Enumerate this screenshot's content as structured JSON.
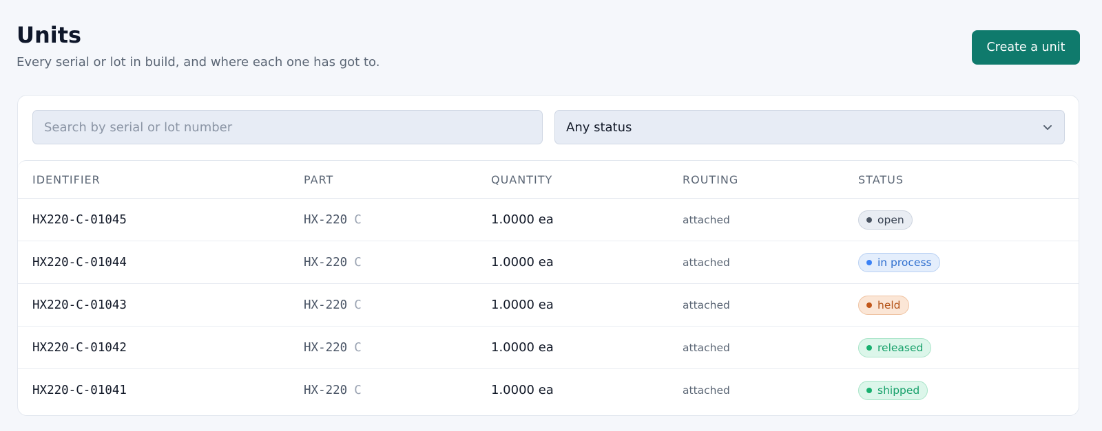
{
  "header": {
    "title": "Units",
    "subtitle": "Every serial or lot in build, and where each one has got to.",
    "create_button_label": "Create a unit"
  },
  "filters": {
    "search_placeholder": "Search by serial or lot number",
    "search_value": "",
    "status_select_value": "Any status",
    "status_icon": "chevron-down-icon"
  },
  "table": {
    "columns": [
      "IDENTIFIER",
      "PART",
      "QUANTITY",
      "ROUTING",
      "STATUS"
    ],
    "rows": [
      {
        "identifier": "HX220-C-01045",
        "part_number": "HX-220",
        "part_rev": "C",
        "quantity": "1.0000 ea",
        "routing": "attached",
        "status": "open"
      },
      {
        "identifier": "HX220-C-01044",
        "part_number": "HX-220",
        "part_rev": "C",
        "quantity": "1.0000 ea",
        "routing": "attached",
        "status": "in process"
      },
      {
        "identifier": "HX220-C-01043",
        "part_number": "HX-220",
        "part_rev": "C",
        "quantity": "1.0000 ea",
        "routing": "attached",
        "status": "held"
      },
      {
        "identifier": "HX220-C-01042",
        "part_number": "HX-220",
        "part_rev": "C",
        "quantity": "1.0000 ea",
        "routing": "attached",
        "status": "released"
      },
      {
        "identifier": "HX220-C-01041",
        "part_number": "HX-220",
        "part_rev": "C",
        "quantity": "1.0000 ea",
        "routing": "attached",
        "status": "shipped"
      }
    ]
  },
  "colors": {
    "accent": "#0f7a6c",
    "status": {
      "open": {
        "bg": "#e9edf3",
        "border": "#cdd4df",
        "text": "#374151",
        "dot": "#4b5563"
      },
      "in process": {
        "bg": "#e4eefc",
        "border": "#b9d1f3",
        "text": "#2f6fcf",
        "dot": "#3b82f6"
      },
      "held": {
        "bg": "#fbe6d6",
        "border": "#efc3a2",
        "text": "#b45317",
        "dot": "#c2571a"
      },
      "released": {
        "bg": "#dcf6ea",
        "border": "#a8e4c8",
        "text": "#16a06a",
        "dot": "#18b06f"
      },
      "shipped": {
        "bg": "#dcf6ea",
        "border": "#a8e4c8",
        "text": "#16a06a",
        "dot": "#18b06f"
      }
    }
  }
}
